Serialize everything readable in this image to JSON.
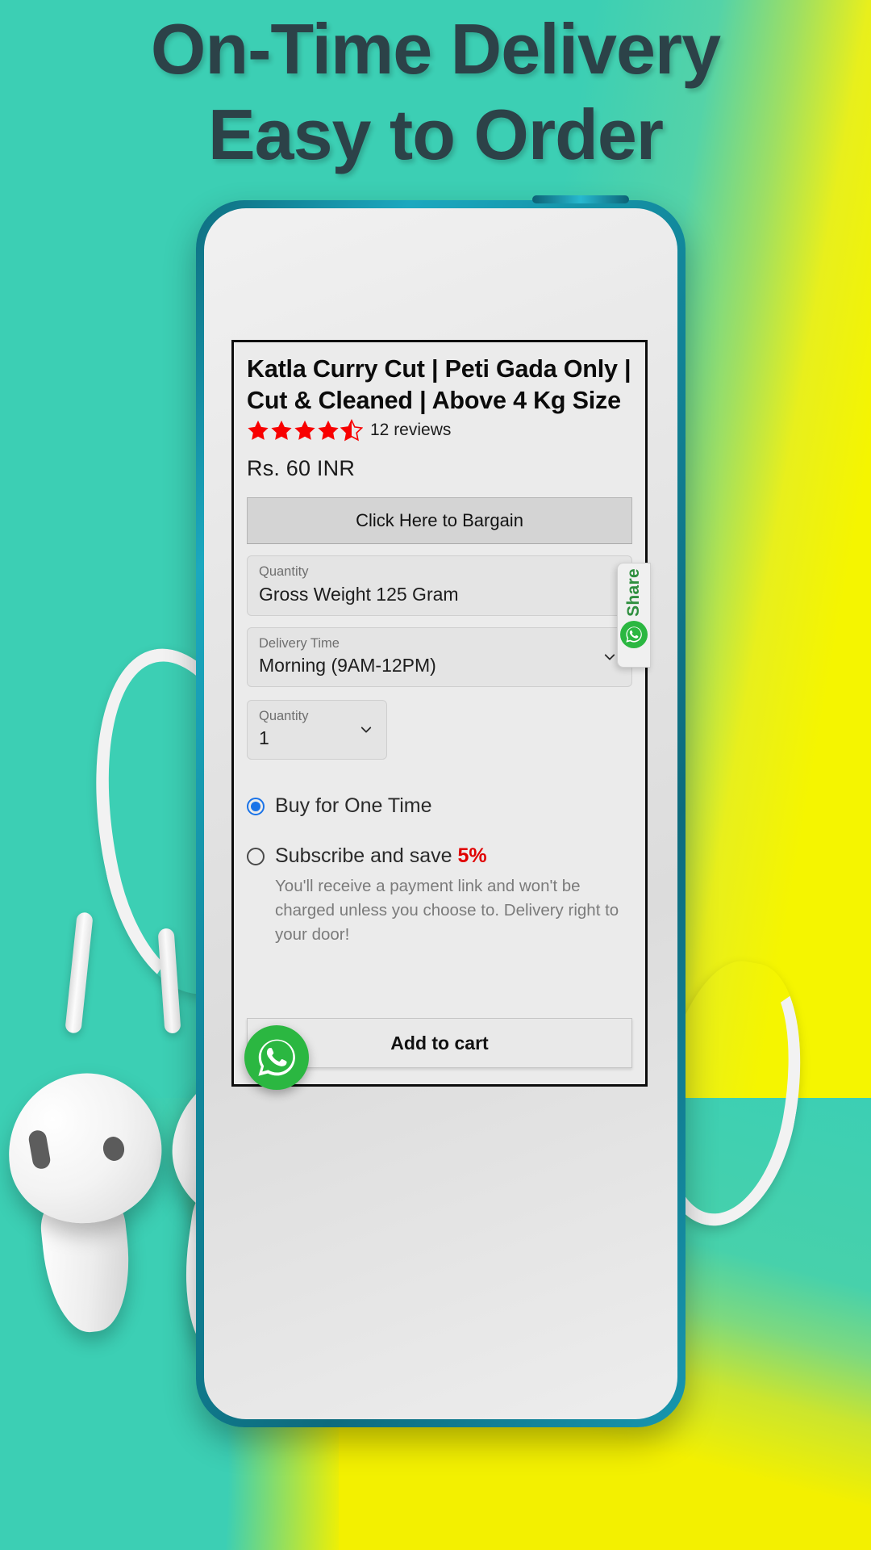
{
  "headline": {
    "line1": "On-Time Delivery",
    "line2": "Easy to Order",
    "color": "#2c4248"
  },
  "theme": {
    "background_teal": "#3ccfb4",
    "background_yellow": "#f5f500",
    "phone_bezel": "#12889c",
    "accent_red": "#e00000",
    "accent_blue": "#1a73e8",
    "whatsapp_green": "#2bb741",
    "share_text_green": "#2f8f3f"
  },
  "product": {
    "title": "Katla Curry Cut | Peti Gada Only | Cut & Cleaned | Above 4 Kg Size",
    "rating_value": 4.5,
    "rating_max": 5,
    "reviews_text": "12 reviews",
    "price": "Rs. 60 INR"
  },
  "bargain_button": {
    "label": "Click Here to Bargain"
  },
  "fields": [
    {
      "name": "quantity-weight",
      "label": "Quantity",
      "value": "Gross Weight 125 Gram",
      "has_chevron": false
    },
    {
      "name": "delivery-time",
      "label": "Delivery Time",
      "value": "Morning (9AM-12PM)",
      "has_chevron": true
    },
    {
      "name": "quantity-count",
      "label": "Quantity",
      "value": "1",
      "has_chevron": true
    }
  ],
  "purchase_options": {
    "option_one": {
      "label": "Buy for One Time",
      "selected": true
    },
    "option_two": {
      "label_prefix": "Subscribe and save ",
      "discount": "5%",
      "selected": false,
      "description": "You'll receive a payment link and won't be charged unless you choose to. Delivery right to your door!"
    }
  },
  "add_to_cart": {
    "label": "Add to cart"
  },
  "share_widget": {
    "label": "Share",
    "icon": "whatsapp-icon"
  },
  "floating_action": {
    "icon": "whatsapp-icon"
  },
  "icons": {
    "star_full": "star-full-icon",
    "star_half": "star-half-icon",
    "chevron_down": "chevron-down-icon",
    "whatsapp": "whatsapp-icon"
  }
}
